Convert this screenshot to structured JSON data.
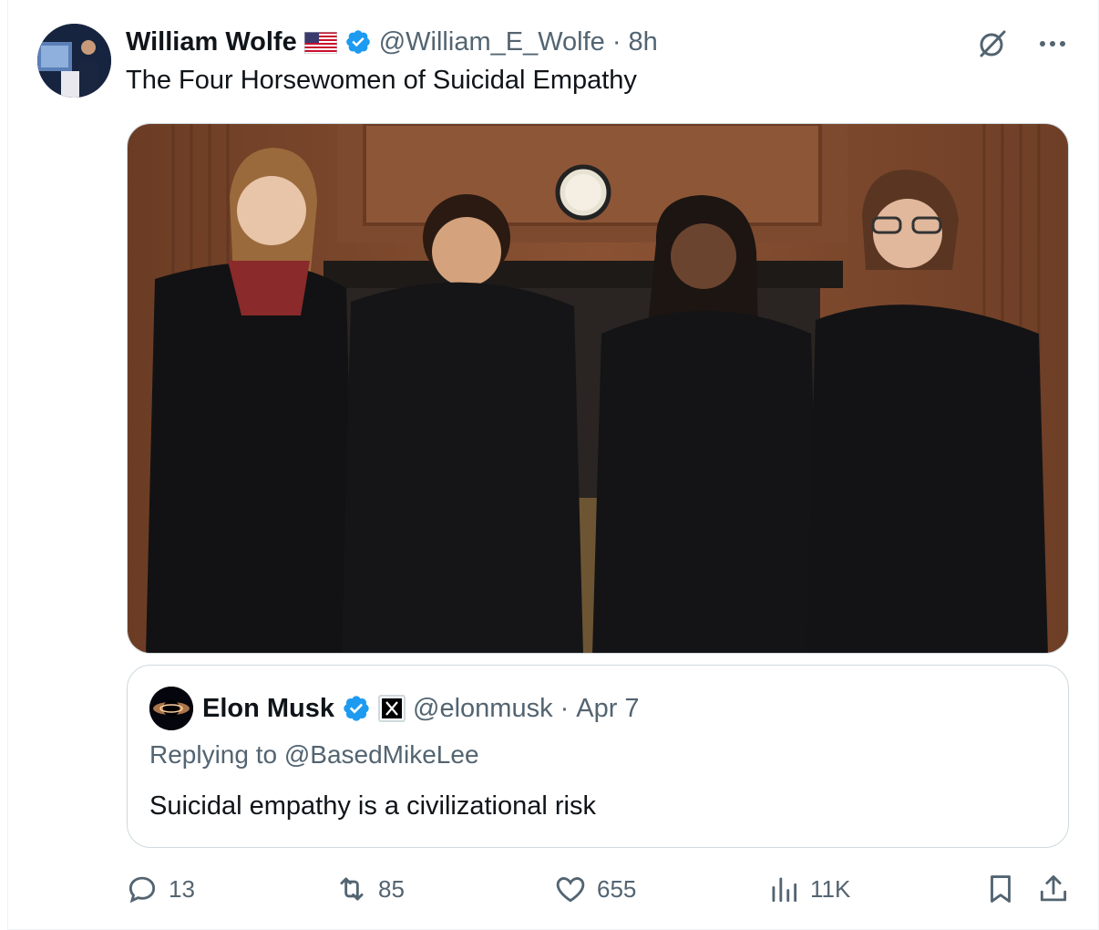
{
  "author": {
    "name": "William Wolfe",
    "handle": "@William_E_Wolfe",
    "separator": "·",
    "time": "8h",
    "flag_icon": "us-flag-icon",
    "verified_icon": "verified-badge-icon"
  },
  "tweet": {
    "text": "The Four Horsewomen of Suicidal Empathy"
  },
  "quoted": {
    "name": "Elon Musk",
    "handle": "@elonmusk",
    "separator": "·",
    "date": "Apr 7",
    "replying_to": "Replying to @BasedMikeLee",
    "text": "Suicidal empathy is a civilizational risk"
  },
  "actions": {
    "replies": "13",
    "reposts": "85",
    "likes": "655",
    "views": "11K"
  },
  "colors": {
    "text": "#0f1419",
    "secondary": "#536471",
    "verified": "#1d9bf0",
    "border": "#cfd9de"
  }
}
